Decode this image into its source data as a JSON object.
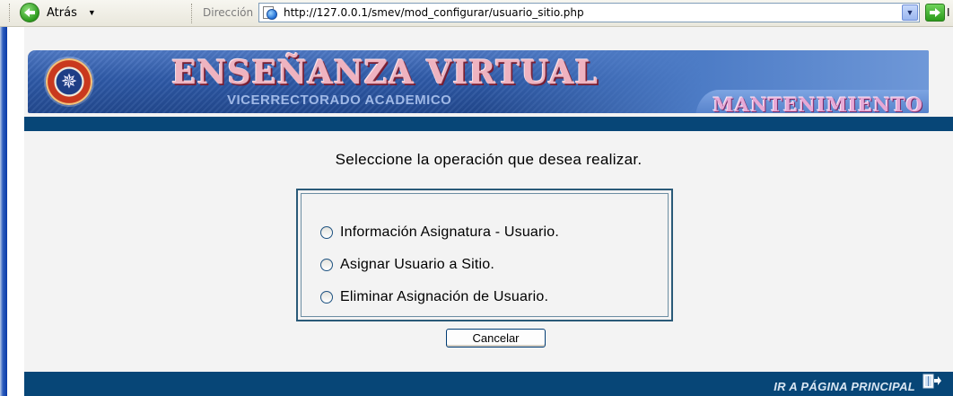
{
  "browser": {
    "back_label": "Atrás",
    "address_label": "Dirección",
    "url": "http://127.0.0.1/smev/mod_configurar/usuario_sitio.php",
    "go_label_truncated": "I"
  },
  "banner": {
    "title": "ENSEÑANZA VIRTUAL",
    "subtitle": "VICERRECTORADO ACADEMICO",
    "section": "MANTENIMIENTO"
  },
  "form": {
    "prompt": "Seleccione la operación que desea realizar.",
    "options": [
      {
        "label": "Información Asignatura - Usuario.",
        "selected": false
      },
      {
        "label": "Asignar Usuario a Sitio.",
        "selected": false
      },
      {
        "label": "Eliminar Asignación de Usuario.",
        "selected": false
      }
    ],
    "cancel_label": "Cancelar"
  },
  "footer": {
    "home_link": "IR A PÁGINA PRINCIPAL"
  },
  "colors": {
    "bar": "#074677",
    "page_bg": "#f3f3f3"
  }
}
